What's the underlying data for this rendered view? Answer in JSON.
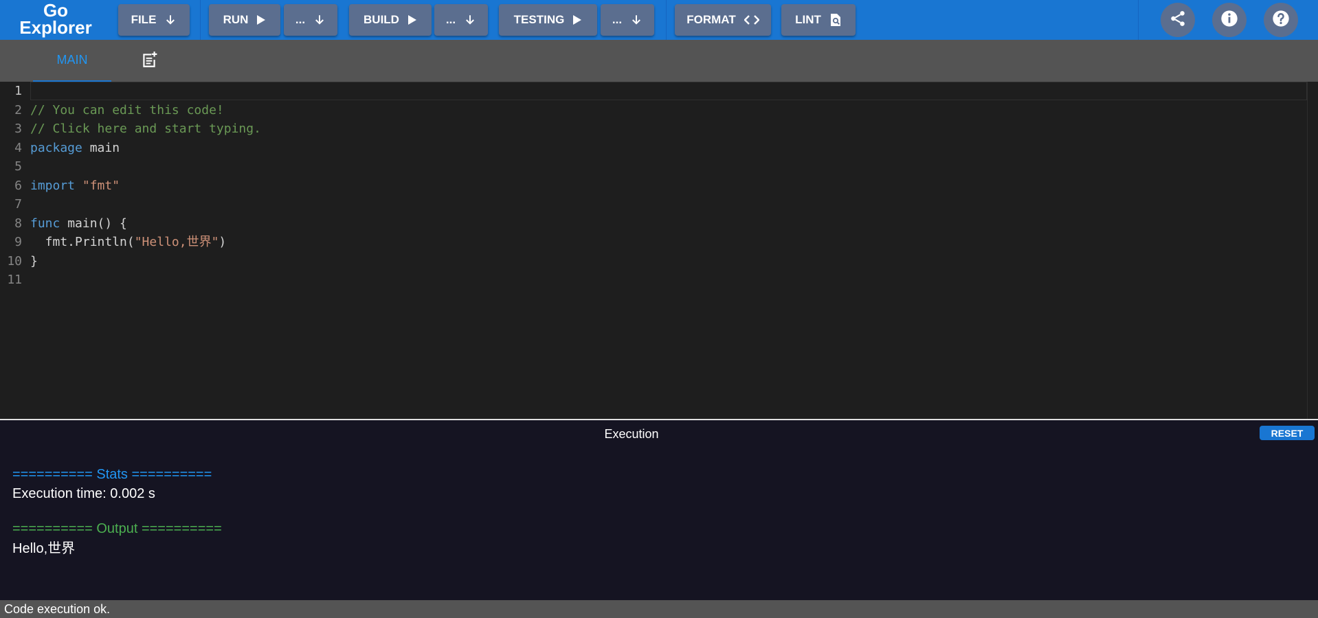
{
  "app": {
    "logo_line1": "Go",
    "logo_line2": "Explorer"
  },
  "toolbar": {
    "file": "FILE",
    "run": "RUN",
    "run_more": "...",
    "build": "BUILD",
    "build_more": "...",
    "testing": "TESTING",
    "testing_more": "...",
    "format": "FORMAT",
    "lint": "LINT",
    "icons": [
      "arrow-down-icon",
      "play-icon",
      "code-brackets-icon",
      "find-in-page-icon",
      "share-icon",
      "info-icon",
      "help-icon"
    ]
  },
  "tabs": {
    "main": "MAIN",
    "add_icon": "note-add-icon"
  },
  "editor": {
    "line_numbers": [
      "1",
      "2",
      "3",
      "4",
      "5",
      "6",
      "7",
      "8",
      "9",
      "10",
      "11"
    ],
    "code": {
      "l2": "// You can edit this code!",
      "l3": "// Click here and start typing.",
      "l4_kw": "package",
      "l4_rest": " main",
      "l6_kw": "import",
      "l6_str": "\"fmt\"",
      "l8_kw": "func",
      "l8_rest": " main() {",
      "l9_pre": "  fmt.Println(",
      "l9_str": "\"Hello,世界\"",
      "l9_post": ")",
      "l10": "}"
    }
  },
  "output": {
    "title": "Execution",
    "reset": "RESET",
    "stats_header": "========== Stats ==========",
    "stats_time": "Execution time: 0.002 s",
    "output_header": "========== Output ==========",
    "output_text": "Hello,世界"
  },
  "status": {
    "text": "Code execution ok."
  },
  "colors": {
    "brand": "#1976d2",
    "button": "#5b6e8f",
    "comment": "#6a9955",
    "keyword": "#569cd6",
    "string": "#ce9178",
    "stats": "#2196f3",
    "output": "#4caf50"
  }
}
